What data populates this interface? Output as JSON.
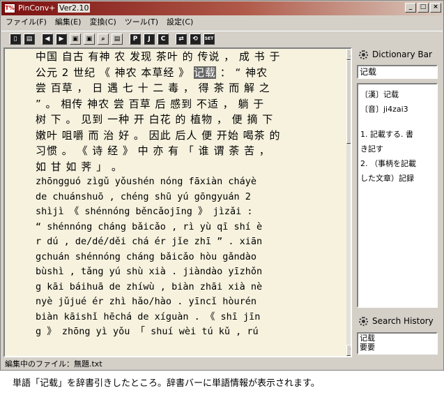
{
  "window": {
    "title_app": "PinConv+",
    "title_version": "Ver2.10",
    "icon_label": "T%",
    "minimize_label": "_",
    "maximize_label": "□",
    "close_label": "×"
  },
  "menu": [
    "ファイル(F)",
    "編集(E)",
    "変換(C)",
    "ツール(T)",
    "設定(C)"
  ],
  "toolbar": {
    "buttons": [
      "▯",
      "▤",
      "◀",
      "▶",
      "▣",
      "▣",
      "⌕",
      "▤",
      "P",
      "J",
      "C",
      "⇄",
      "⟲",
      "SET"
    ]
  },
  "editor": {
    "chinese_lines_before": [
      "中国 自古 有神 农 发现 茶叶 的 传说 ， 成 书 于",
      "公元 2 世纪 《 神农 本草经 》"
    ],
    "highlight": "记载",
    "chinese_line2_after": "： “ 神农",
    "chinese_lines_after": [
      "尝 百草 ， 日 遇 七 十 二 毒 ， 得 茶 而 解 之",
      "” 。 相传 神农 尝 百草 后 感到 不适 ， 躺 于",
      "树 下 。 见到 一种 开 白花 的 植物 ， 便 摘 下",
      "嫩叶 咀嚼 而 治 好 。 因此 后人 便 开始 喝茶 的",
      "习惯 。 《 诗 经 》 中 亦 有 「 谁 谓 荼 苦 ，",
      "如 甘 如 荠 」 。"
    ],
    "pinyin_lines": [
      "zhōngguó zìgǔ yǒushén nóng fāxiàn cháyè",
      "de chuánshuō , chéng shū yú gōngyuán 2",
      "shìjì 《 shénnóng běncǎojīng 》 jìzǎi :",
      "“ shénnóng cháng bǎicǎo , rì yù qī shí è",
      "r dú , de/dé/děi chá ér jǐe zhī ” . xiān",
      "gchuán shénnóng cháng bǎicǎo hòu gǎndào",
      "bùshì , tǎng yú shù xià . jiàndào yīzhǒn",
      "g kāi báihuā de zhíwù , biàn zhāi xià nè",
      "nyè jǔjué ér zhì hǎo/hào . yīncǐ hòurén",
      "biàn kāishǐ hēchá de xíguàn . 《 shī jīn",
      "g 》 zhōng yì yǒu 「 shuí wèi tú kǔ , rú"
    ]
  },
  "status": {
    "label": "編集中のファイル：無題.txt"
  },
  "dictionary": {
    "title": "Dictionary Bar",
    "search_value": "记载",
    "lines": [
      "〔漢〕记载",
      "〔音〕ji4zai3"
    ],
    "definitions": [
      "1. 記載する. 書",
      "き記す",
      "2. （事柄を記載",
      "した文章）記録"
    ]
  },
  "history": {
    "title": "Search History",
    "items": [
      "记载",
      "要要"
    ]
  },
  "caption": "単語「记载」を辞書引きしたところ。辞書バーに単語情報が表示されます。"
}
